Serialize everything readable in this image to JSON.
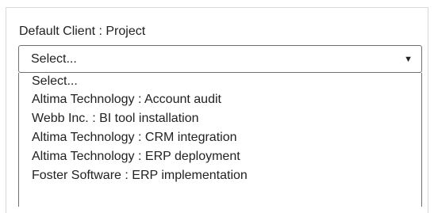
{
  "field": {
    "label": "Default Client : Project"
  },
  "select": {
    "selected_value": "Select...",
    "caret_icon": "triangle-down-icon",
    "caret_glyph": "▼"
  },
  "dropdown": {
    "options": [
      {
        "label": "Select..."
      },
      {
        "label": "Altima Technology : Account audit"
      },
      {
        "label": "Webb Inc. : BI tool installation"
      },
      {
        "label": "Altima Technology : CRM integration"
      },
      {
        "label": "Altima Technology : ERP deployment"
      },
      {
        "label": "Foster Software : ERP implementation"
      }
    ]
  },
  "colors": {
    "text": "#222222",
    "select_border": "#6f6f6f",
    "panel_border": "#d8d8d8",
    "background": "#ffffff"
  }
}
